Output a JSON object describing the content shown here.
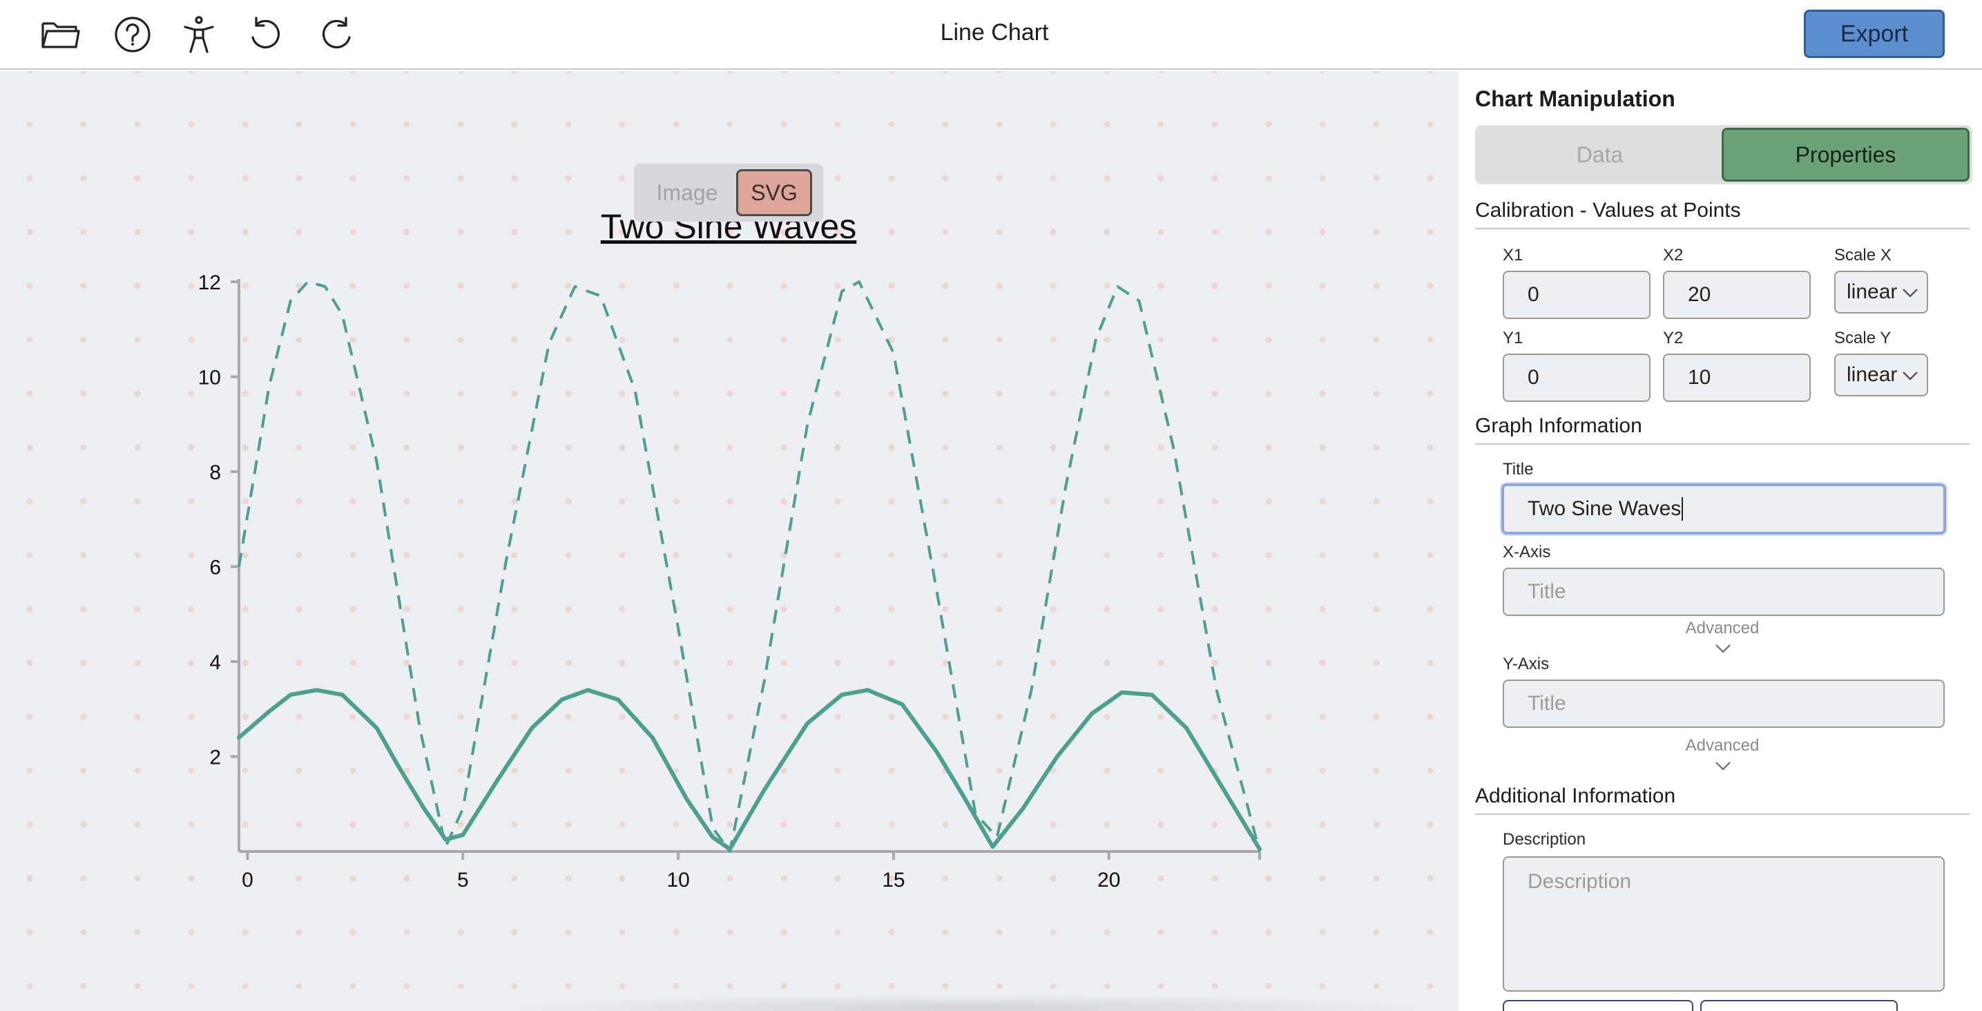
{
  "app": {
    "title": "Line Chart"
  },
  "toolbar": {
    "icons": [
      "folder-open-icon",
      "help-circle-icon",
      "accessibility-icon",
      "undo-icon",
      "redo-icon"
    ],
    "export_label": "Export"
  },
  "view_toggle": {
    "options": [
      "Image",
      "SVG"
    ],
    "selected": "SVG"
  },
  "colors": {
    "accent_blue": "#5b8fd0",
    "properties_green": "#6aa377",
    "svg_toggle": "#dca79a",
    "series_color": "#4ca08f"
  },
  "chart_data": {
    "type": "line",
    "title": "Two Sine Waves",
    "xlabel": "",
    "ylabel": "",
    "xlim": [
      -0.2,
      23.5
    ],
    "ylim": [
      0,
      12
    ],
    "x_ticks": [
      0,
      5,
      10,
      15,
      20
    ],
    "y_ticks": [
      2,
      4,
      6,
      8,
      10,
      12
    ],
    "grid": false,
    "series": [
      {
        "style": "dashed",
        "x": [
          -0.2,
          0.5,
          1.0,
          1.4,
          1.8,
          2.2,
          3.0,
          4.0,
          4.6,
          5.0,
          6.0,
          7.0,
          7.6,
          8.2,
          9.0,
          10.0,
          10.8,
          11.2,
          12.0,
          13.0,
          13.8,
          14.2,
          15.0,
          16.0,
          16.9,
          17.4,
          18.2,
          19.0,
          19.7,
          20.2,
          20.7,
          21.5,
          22.5,
          23.5
        ],
        "y": [
          6.0,
          9.8,
          11.6,
          12.0,
          11.9,
          11.3,
          8.2,
          2.6,
          0.1,
          0.9,
          6.1,
          10.7,
          11.9,
          11.7,
          9.7,
          4.7,
          0.5,
          0.0,
          3.6,
          9.0,
          11.8,
          12.0,
          10.5,
          5.5,
          0.8,
          0.3,
          3.4,
          7.7,
          10.8,
          11.9,
          11.6,
          8.5,
          3.4,
          0.0
        ]
      },
      {
        "style": "solid",
        "x": [
          -0.2,
          0.5,
          1.0,
          1.6,
          2.2,
          3.0,
          3.5,
          4.1,
          4.6,
          5.0,
          5.8,
          6.6,
          7.3,
          7.9,
          8.6,
          9.4,
          10.2,
          10.8,
          11.2,
          12.0,
          13.0,
          13.8,
          14.4,
          15.2,
          16.0,
          16.6,
          17.3,
          18.0,
          18.8,
          19.6,
          20.3,
          21.0,
          21.8,
          22.6,
          23.5
        ],
        "y": [
          2.4,
          2.95,
          3.3,
          3.4,
          3.3,
          2.6,
          1.8,
          0.9,
          0.25,
          0.35,
          1.5,
          2.6,
          3.2,
          3.4,
          3.2,
          2.4,
          1.1,
          0.3,
          0.05,
          1.3,
          2.7,
          3.3,
          3.4,
          3.1,
          2.1,
          1.2,
          0.1,
          0.9,
          2.0,
          2.9,
          3.35,
          3.3,
          2.6,
          1.4,
          0.05
        ]
      }
    ]
  },
  "panel": {
    "title": "Chart Manipulation",
    "tabs": [
      "Data",
      "Properties"
    ],
    "active_tab": "Properties",
    "calibration": {
      "heading": "Calibration - Values at Points",
      "x1": {
        "label": "X1",
        "value": "0"
      },
      "x2": {
        "label": "X2",
        "value": "20"
      },
      "y1": {
        "label": "Y1",
        "value": "0"
      },
      "y2": {
        "label": "Y2",
        "value": "10"
      },
      "scale_x": {
        "label": "Scale X",
        "value": "linear"
      },
      "scale_y": {
        "label": "Scale Y",
        "value": "linear"
      }
    },
    "graph_info": {
      "heading": "Graph Information",
      "title_label": "Title",
      "title_value": "Two Sine Waves",
      "x_axis_label": "X-Axis",
      "x_axis_placeholder": "Title",
      "y_axis_label": "Y-Axis",
      "y_axis_placeholder": "Title",
      "advanced_label": "Advanced"
    },
    "additional": {
      "heading": "Additional Information",
      "description_label": "Description",
      "description_placeholder": "Description"
    }
  }
}
